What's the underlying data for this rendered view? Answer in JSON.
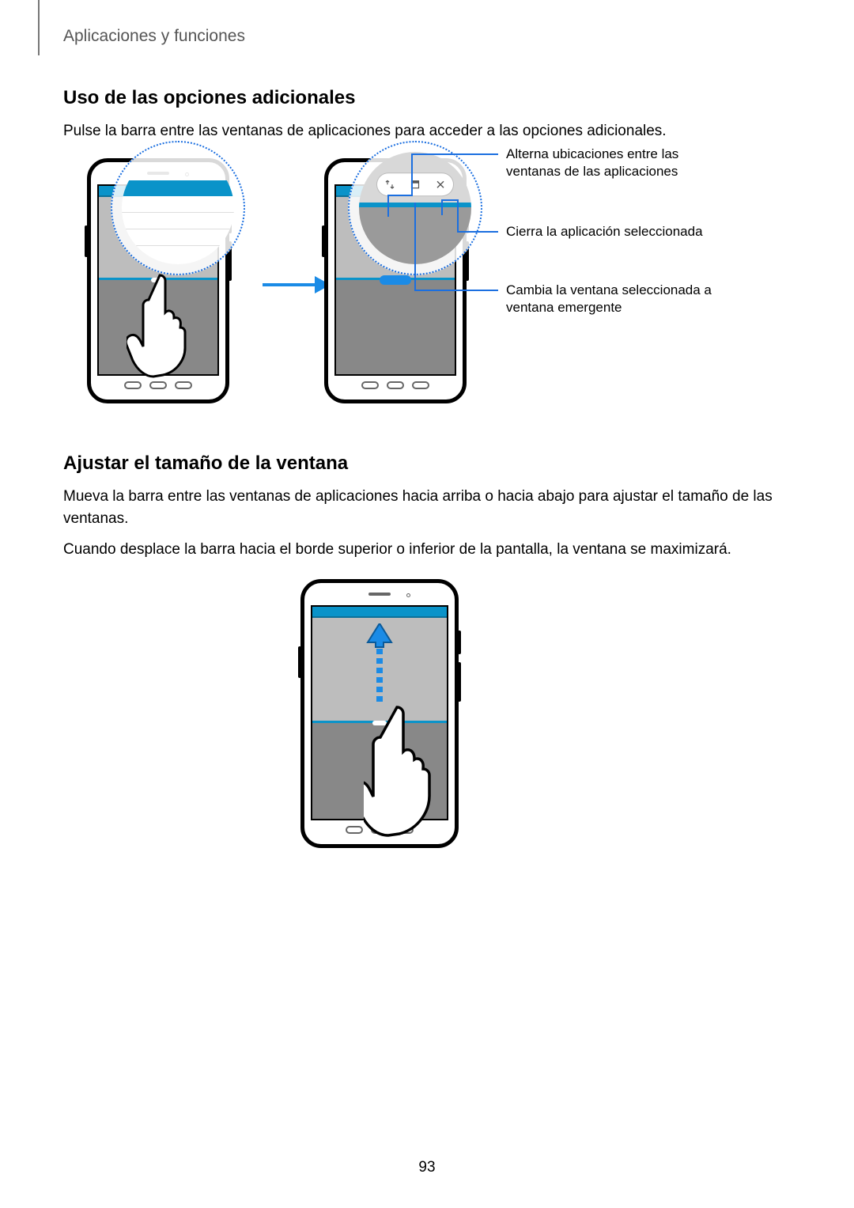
{
  "header": {
    "breadcrumb": "Aplicaciones y funciones"
  },
  "section1": {
    "title": "Uso de las opciones adicionales",
    "body": "Pulse la barra entre las ventanas de aplicaciones para acceder a las opciones adicionales."
  },
  "callouts": {
    "swap": "Alterna ubicaciones entre las ventanas de las aplicaciones",
    "close": "Cierra la aplicación seleccionada",
    "popup": "Cambia la ventana seleccionada a ventana emergente"
  },
  "section2": {
    "title": "Ajustar el tamaño de la ventana",
    "body1": "Mueva la barra entre las ventanas de aplicaciones hacia arriba o hacia abajo para ajustar el tamaño de las ventanas.",
    "body2": "Cuando desplace la barra hacia el borde superior o inferior de la pantalla, la ventana se maximizará."
  },
  "page_number": "93"
}
